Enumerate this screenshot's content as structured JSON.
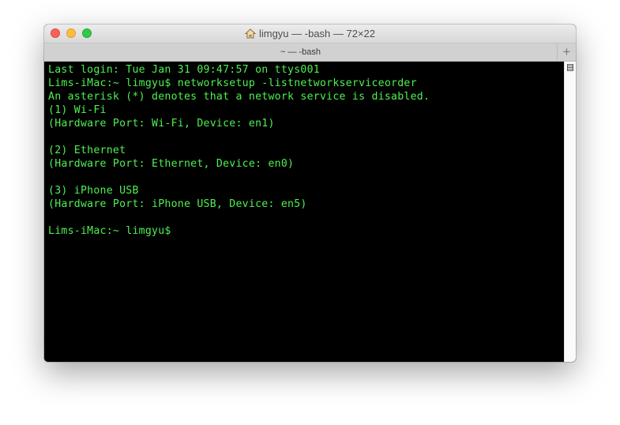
{
  "window": {
    "title": "limgyu — -bash — 72×22"
  },
  "tabs": {
    "active_label": "~ — -bash",
    "new_tab_label": "+"
  },
  "terminal": {
    "lines": [
      "Last login: Tue Jan 31 09:47:57 on ttys001",
      "Lims-iMac:~ limgyu$ networksetup -listnetworkserviceorder",
      "An asterisk (*) denotes that a network service is disabled.",
      "(1) Wi-Fi",
      "(Hardware Port: Wi-Fi, Device: en1)",
      "",
      "(2) Ethernet",
      "(Hardware Port: Ethernet, Device: en0)",
      "",
      "(3) iPhone USB",
      "(Hardware Port: iPhone USB, Device: en5)",
      "",
      "Lims-iMac:~ limgyu$"
    ]
  },
  "icons": {
    "title_icon": "home-icon",
    "scroll_marker": "scroll-marker-icon"
  },
  "colors": {
    "terminal_background": "#000000",
    "terminal_text": "#4ef051",
    "close": "#fc605c",
    "minimize": "#fdbc40",
    "maximize": "#34c84a"
  }
}
